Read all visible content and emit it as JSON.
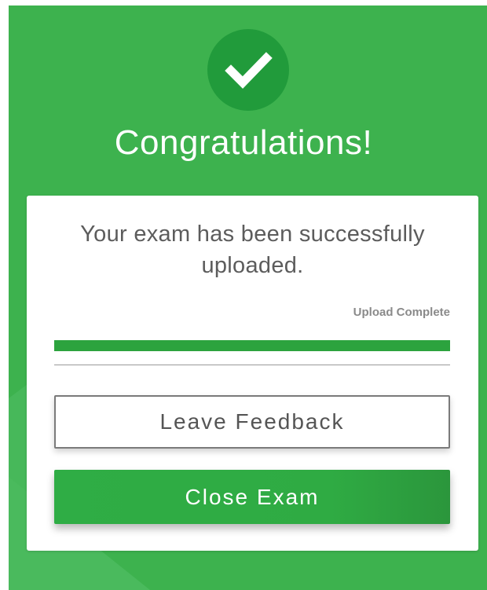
{
  "header": {
    "title": "Congratulations!",
    "icon": "check-icon"
  },
  "card": {
    "message": "Your exam has been successfully uploaded.",
    "status_label": "Upload Complete",
    "progress_fraction": 1.0
  },
  "actions": {
    "feedback_label": "Leave Feedback",
    "close_label": "Close Exam"
  },
  "colors": {
    "background_green": "#3db24e",
    "check_circle": "#219b3b",
    "progress": "#2ca33e",
    "close_button": "#2fad45"
  }
}
